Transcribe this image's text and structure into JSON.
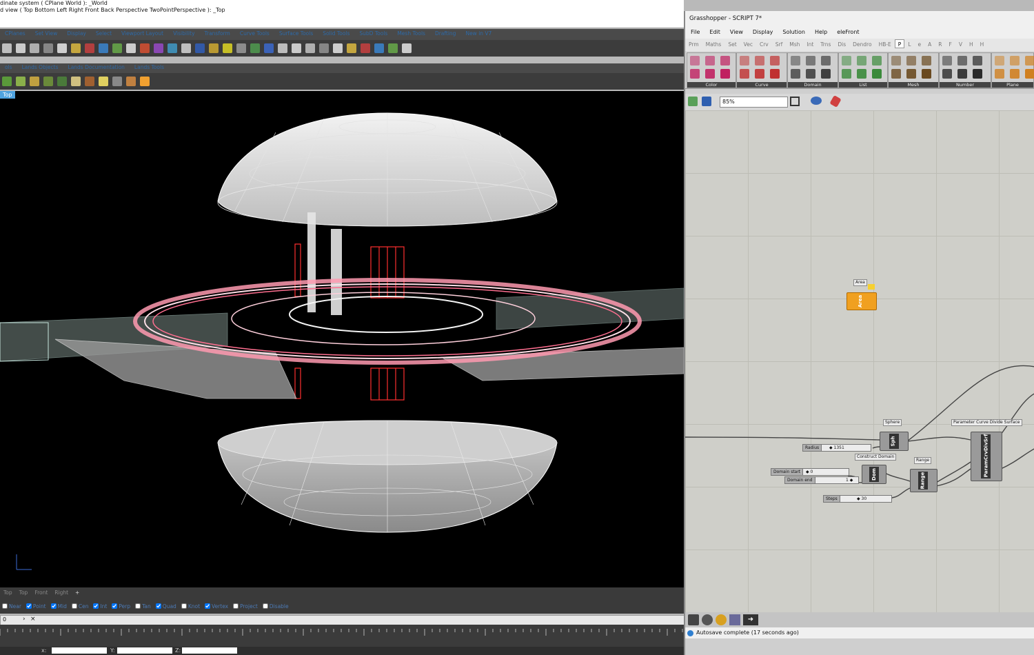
{
  "rhino": {
    "cmd_line1": "dinate system ( CPlane  World ): _World",
    "cmd_line2": "d view ( Top  Bottom  Left  Right  Front  Back  Perspective  TwoPointPerspective ): _Top",
    "tabs": [
      "CPlanes",
      "Set View",
      "Display",
      "Select",
      "Viewport Layout",
      "Visibility",
      "Transform",
      "Curve Tools",
      "Surface Tools",
      "Solid Tools",
      "SubD Tools",
      "Mesh Tools",
      "Drafting",
      "New in V7"
    ],
    "tabs2": [
      "ols",
      "Lands Objects",
      "Lands Documentation",
      "Lands Tools"
    ],
    "viewport_label": "Top",
    "view_tabs": [
      "Top",
      "Top",
      "Front",
      "Right"
    ],
    "view_tabs_add": "+",
    "osnaps": [
      {
        "label": "Near",
        "checked": false
      },
      {
        "label": "Point",
        "checked": true
      },
      {
        "label": "Mid",
        "checked": true
      },
      {
        "label": "Cen",
        "checked": false
      },
      {
        "label": "Int",
        "checked": true
      },
      {
        "label": "Perp",
        "checked": true
      },
      {
        "label": "Tan",
        "checked": false
      },
      {
        "label": "Quad",
        "checked": true
      },
      {
        "label": "Knot",
        "checked": false
      },
      {
        "label": "Vertex",
        "checked": true
      },
      {
        "label": "Project",
        "checked": false
      },
      {
        "label": "Disable",
        "checked": false
      }
    ],
    "timeline_value": "0",
    "coord_x": "x:",
    "coord_y": "Y:",
    "coord_z": "Z:"
  },
  "grasshopper": {
    "title": "Grasshopper - SCRIPT 7*",
    "menu": [
      "File",
      "Edit",
      "View",
      "Display",
      "Solution",
      "Help",
      "eleFront"
    ],
    "tabs": [
      "Prm",
      "Maths",
      "Set",
      "Vec",
      "Crv",
      "Srf",
      "Msh",
      "Int",
      "Trns",
      "Dis",
      "Dendro",
      "HB-E",
      "P",
      "L",
      "e",
      "A",
      "R",
      "F",
      "V",
      "H",
      "H"
    ],
    "active_tab": "P",
    "ribbon_groups": [
      "Color",
      "Curve",
      "Domain",
      "List",
      "Mesh",
      "Number",
      "Plane"
    ],
    "zoom": "85%",
    "status": "Autosave complete (17 seconds ago)",
    "nodes": {
      "area": {
        "label": "Area",
        "text": "Area"
      },
      "sphere": {
        "label": "Sphere",
        "text": "Sph"
      },
      "radius_slider": {
        "label": "Radius",
        "value": "◆ 1351"
      },
      "construct_domain": {
        "label": "Construct Domain",
        "text": "Dom"
      },
      "domain_start": {
        "label": "Domain start",
        "value": "◆ 0"
      },
      "domain_end": {
        "label": "Domain end",
        "value": "1 ◆"
      },
      "range": {
        "label": "Range",
        "text": "Range"
      },
      "steps": {
        "label": "Steps",
        "value": "◆ 30"
      },
      "param": {
        "label": "Parameter Curve Divide Surface",
        "text": "ParamCrvDivSrf"
      }
    }
  },
  "colors": {
    "rhino_bg": "#3c3c3c",
    "viewport": "#000000",
    "tab_text": "#2d6aa8",
    "gh_canvas": "#cfcfc9",
    "gh_area_node": "#f0a020"
  }
}
